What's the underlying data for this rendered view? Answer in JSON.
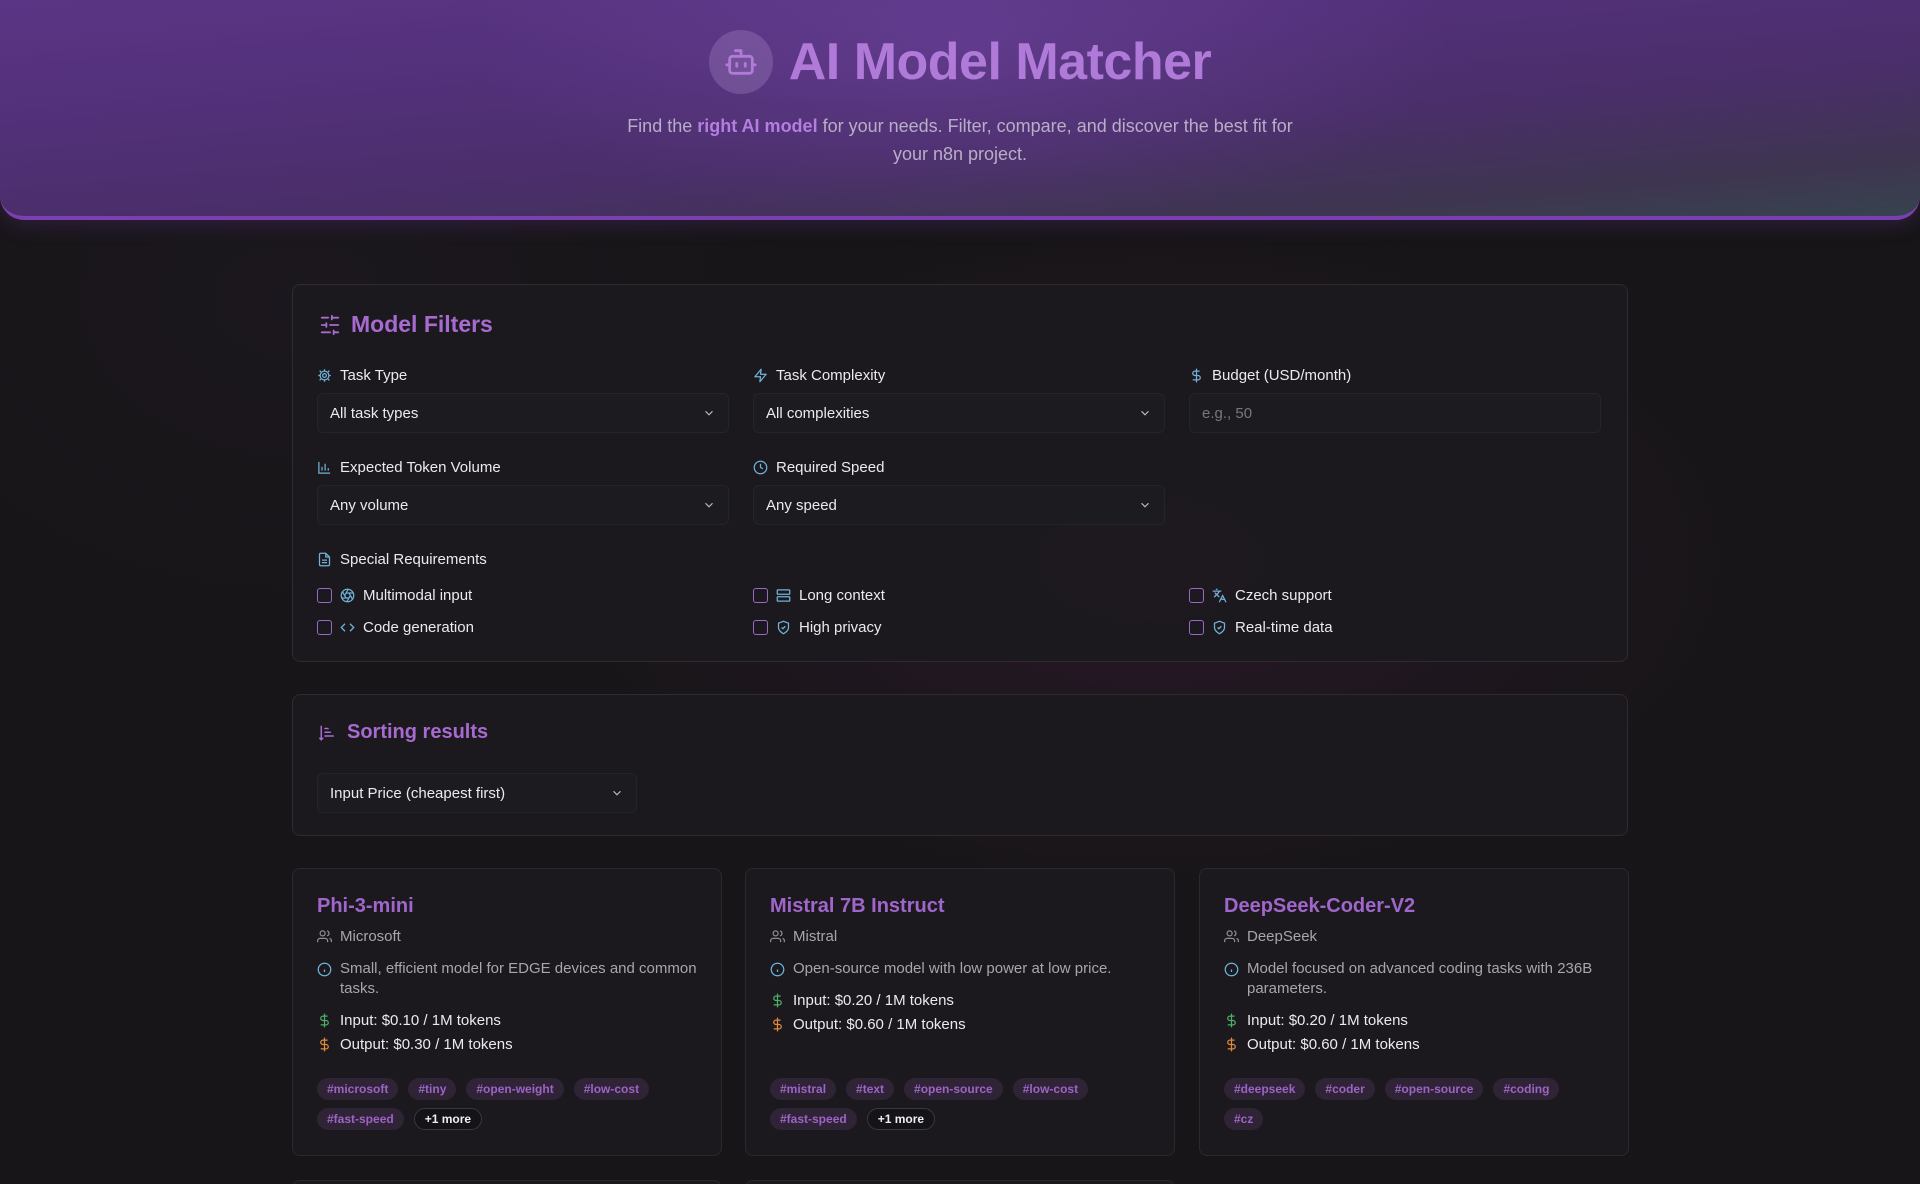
{
  "header": {
    "title": "AI Model Matcher",
    "subtitle_before": "Find the ",
    "subtitle_highlight": "right AI model",
    "subtitle_after": " for your needs. Filter, compare, and discover the best fit for your n8n project."
  },
  "filters": {
    "title": "Model Filters",
    "task_type": {
      "label": "Task Type",
      "value": "All task types"
    },
    "task_complexity": {
      "label": "Task Complexity",
      "value": "All complexities"
    },
    "budget": {
      "label": "Budget (USD/month)",
      "placeholder": "e.g., 50",
      "value": ""
    },
    "token_volume": {
      "label": "Expected Token Volume",
      "value": "Any volume"
    },
    "speed": {
      "label": "Required Speed",
      "value": "Any speed"
    },
    "special": {
      "label": "Special Requirements",
      "options": {
        "multimodal": "Multimodal input",
        "long_context": "Long context",
        "czech": "Czech support",
        "code": "Code generation",
        "privacy": "High privacy",
        "realtime": "Real-time data"
      }
    }
  },
  "sorting": {
    "title": "Sorting results",
    "value": "Input Price (cheapest first)"
  },
  "models": [
    {
      "name": "Phi-3-mini",
      "provider": "Microsoft",
      "description": "Small, efficient model for EDGE devices and common tasks.",
      "input": "Input: $0.10 / 1M tokens",
      "output": "Output: $0.30 / 1M tokens",
      "tags": [
        "#microsoft",
        "#tiny",
        "#open-weight",
        "#low-cost",
        "#fast-speed"
      ],
      "more": "+1 more"
    },
    {
      "name": "Mistral 7B Instruct",
      "provider": "Mistral",
      "description": "Open-source model with low power at low price.",
      "input": "Input: $0.20 / 1M tokens",
      "output": "Output: $0.60 / 1M tokens",
      "tags": [
        "#mistral",
        "#text",
        "#open-source",
        "#low-cost",
        "#fast-speed"
      ],
      "more": "+1 more"
    },
    {
      "name": "DeepSeek-Coder-V2",
      "provider": "DeepSeek",
      "description": "Model focused on advanced coding tasks with 236B parameters.",
      "input": "Input: $0.20 / 1M tokens",
      "output": "Output: $0.60 / 1M tokens",
      "tags": [
        "#deepseek",
        "#coder",
        "#open-source",
        "#coding",
        "#cz"
      ],
      "more": ""
    }
  ],
  "colors": {
    "accent": "#a76ad0",
    "icon_blue": "#6fb3d9",
    "price_green": "#4caf6a",
    "price_orange": "#e08a3c"
  }
}
